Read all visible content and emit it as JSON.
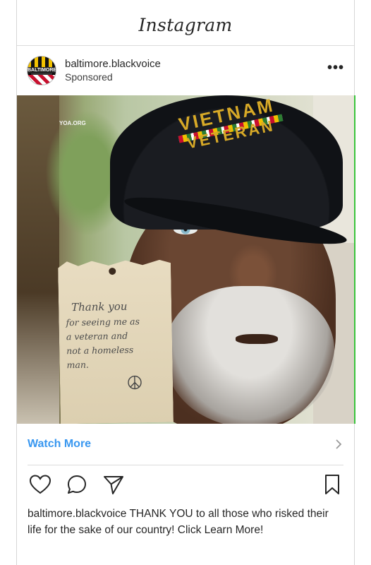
{
  "app": {
    "title": "Instagram"
  },
  "post": {
    "username": "baltimore.blackvoice",
    "sponsored_label": "Sponsored",
    "avatar_text": "BALTIMORE",
    "more_label": "•••",
    "photo": {
      "watermark": "YOA.ORG",
      "cap_line1": "VIETNAM",
      "cap_line2": "VETERAN",
      "note_line1": "Thank you",
      "note_line2": "for seeing me as",
      "note_line3": "a veteran and",
      "note_line4": "not a homeless",
      "note_line5": "man."
    },
    "cta_label": "Watch More",
    "actions": {
      "like": "heart-icon",
      "comment": "comment-icon",
      "share": "share-icon",
      "save": "bookmark-icon"
    },
    "caption_user": "baltimore.blackvoice",
    "caption_text": "THANK YOU to all those who risked their life for the sake of our country! Click Learn More!"
  },
  "colors": {
    "cta_blue": "#3897f0",
    "border": "#dbdbdb",
    "text": "#262626"
  }
}
